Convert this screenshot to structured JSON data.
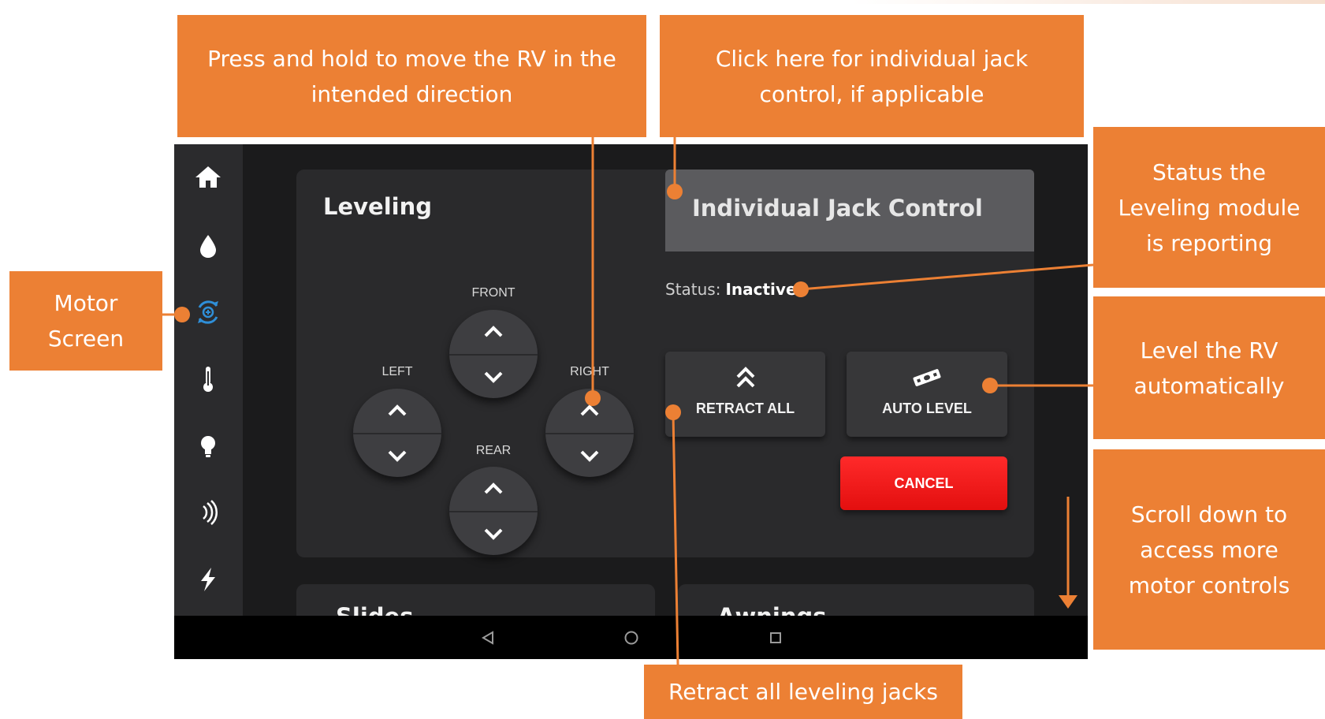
{
  "callouts": {
    "move_rv": [
      "Press and hold to move the RV in the",
      "intended direction"
    ],
    "individual_jack": [
      "Click here for individual jack",
      "control, if applicable"
    ],
    "status": [
      "Status the",
      "Leveling module",
      "is reporting"
    ],
    "motor_screen": [
      "Motor",
      "Screen"
    ],
    "level_rv": [
      "Level the RV",
      "automatically"
    ],
    "scroll_down": [
      "Scroll down to",
      "access more",
      "motor controls"
    ],
    "retract_all": [
      "Retract all leveling jacks"
    ]
  },
  "sidebar": {
    "icons": [
      "home-icon",
      "water-drop-icon",
      "motor-icon",
      "thermometer-icon",
      "light-bulb-icon",
      "signal-icon",
      "lightning-icon"
    ],
    "active": "motor-icon"
  },
  "leveling": {
    "title": "Leveling",
    "labels": {
      "front": "FRONT",
      "rear": "REAR",
      "left": "LEFT",
      "right": "RIGHT"
    },
    "individual_jack_control": "Individual Jack Control",
    "status_label": "Status:",
    "status_value": "Inactive",
    "retract_all": "RETRACT ALL",
    "auto_level": "AUTO LEVEL",
    "cancel": "CANCEL"
  },
  "lower_cards": {
    "slides": "Slides",
    "awnings": "Awnings"
  },
  "colors": {
    "callout": "#ec8034",
    "cancel": "#ff2a2a",
    "active_icon": "#2f8fd8"
  }
}
